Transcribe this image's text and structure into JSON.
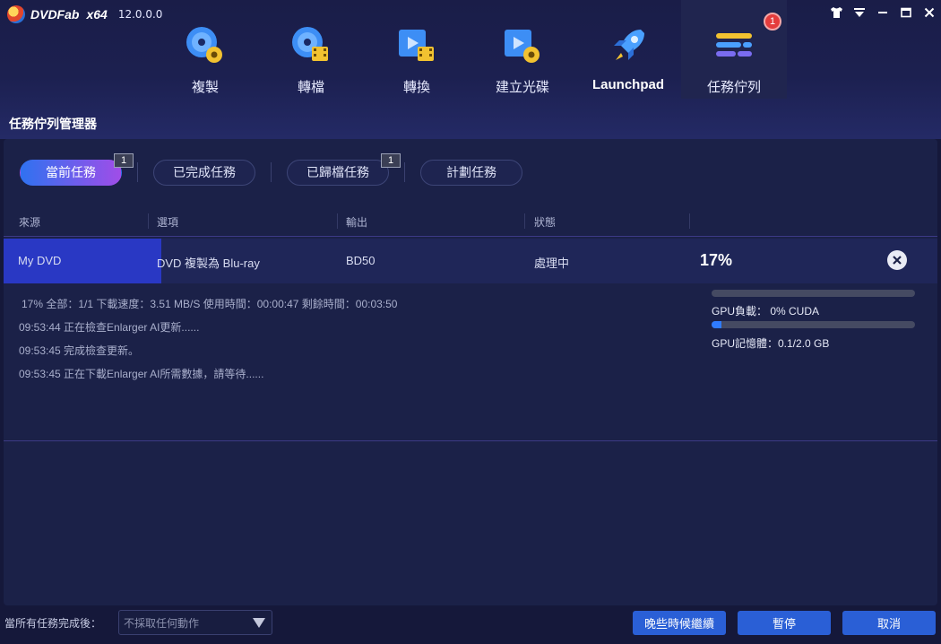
{
  "app": {
    "name": "DVDFab",
    "arch": "x64",
    "version": "12.0.0.0"
  },
  "nav": [
    {
      "label": "複製",
      "icon": "copy-disc-icon"
    },
    {
      "label": "轉檔",
      "icon": "ripper-icon"
    },
    {
      "label": "轉換",
      "icon": "converter-icon"
    },
    {
      "label": "建立光碟",
      "icon": "creator-icon"
    },
    {
      "label": "Launchpad",
      "icon": "rocket-icon"
    },
    {
      "label": "任務佇列",
      "icon": "task-queue-icon",
      "badge": "1",
      "active": true
    }
  ],
  "page_title": "任務佇列管理器",
  "tabs": [
    {
      "label": "當前任務",
      "badge": "1",
      "active": true
    },
    {
      "label": "已完成任務"
    },
    {
      "label": "已歸檔任務",
      "badge": "1"
    },
    {
      "label": "計劃任務"
    }
  ],
  "table": {
    "headers": [
      "來源",
      "選項",
      "輸出",
      "狀態"
    ],
    "row": {
      "source": "My DVD",
      "option": "DVD 複製為 Blu-ray",
      "output": "BD50",
      "status": "處理中",
      "percent": "17%",
      "progress": 0.17
    }
  },
  "details": {
    "stats": "17%   全部：1/1  下載速度：3.51 MB/S  使用時間：00:00:47  剩餘時間：00:03:50",
    "log": [
      "09:53:44  正在檢查Enlarger AI更新......",
      "09:53:45  完成檢查更新。",
      "09:53:45  正在下載Enlarger AI所需數據，請等待......"
    ],
    "gpu_load_label": "GPU負載：  0%   CUDA",
    "gpu_load": 0.0,
    "gpu_mem_label": "GPU記憶體：0.1/2.0 GB",
    "gpu_mem": 0.05
  },
  "footer": {
    "after_label": "當所有任務完成後：",
    "after_value": "不採取任何動作",
    "later_label": "晚些時候繼續",
    "pause_label": "暫停",
    "cancel_label": "取消"
  },
  "colors": {
    "accent": "#2a5fd6",
    "progress": "#2938c4",
    "badge_red": "#e53c3c"
  }
}
